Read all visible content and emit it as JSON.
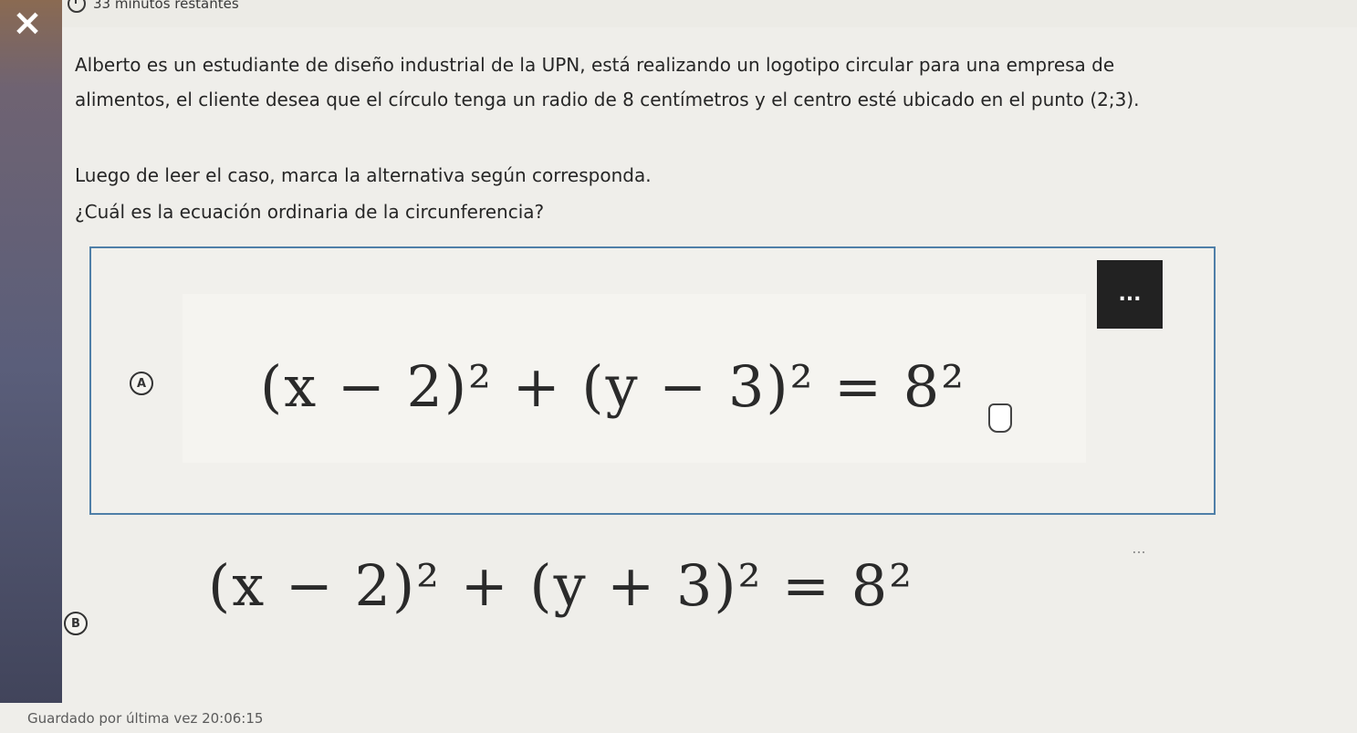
{
  "header": {
    "close_icon": "×",
    "timer_text": "33 minutos restantes"
  },
  "content": {
    "paragraph": "Alberto es un estudiante de diseño industrial de la UPN, está realizando un logotipo circular para una empresa de alimentos, el cliente desea que el círculo tenga un radio de 8 centímetros y el centro esté ubicado en el punto (2;3).",
    "instruction": "Luego de leer el caso, marca la alternativa según corresponda.",
    "question": "¿Cuál es la ecuación ordinaria de la circunferencia?"
  },
  "options": [
    {
      "letter": "A",
      "equation": "(x − 2)² + (y − 3)² = 8²"
    },
    {
      "letter": "B",
      "equation": "(x − 2)² + (y + 3)² = 8²"
    }
  ],
  "more_menu_label": "...",
  "footer": {
    "saved_text": "Guardado por última vez 20:06:15"
  },
  "colors": {
    "selected_border": "#4f7fa8",
    "more_button_bg": "#222222"
  },
  "icons": {
    "close": "close-icon",
    "timer": "timer-icon",
    "cursor": "hand-cursor-icon"
  }
}
